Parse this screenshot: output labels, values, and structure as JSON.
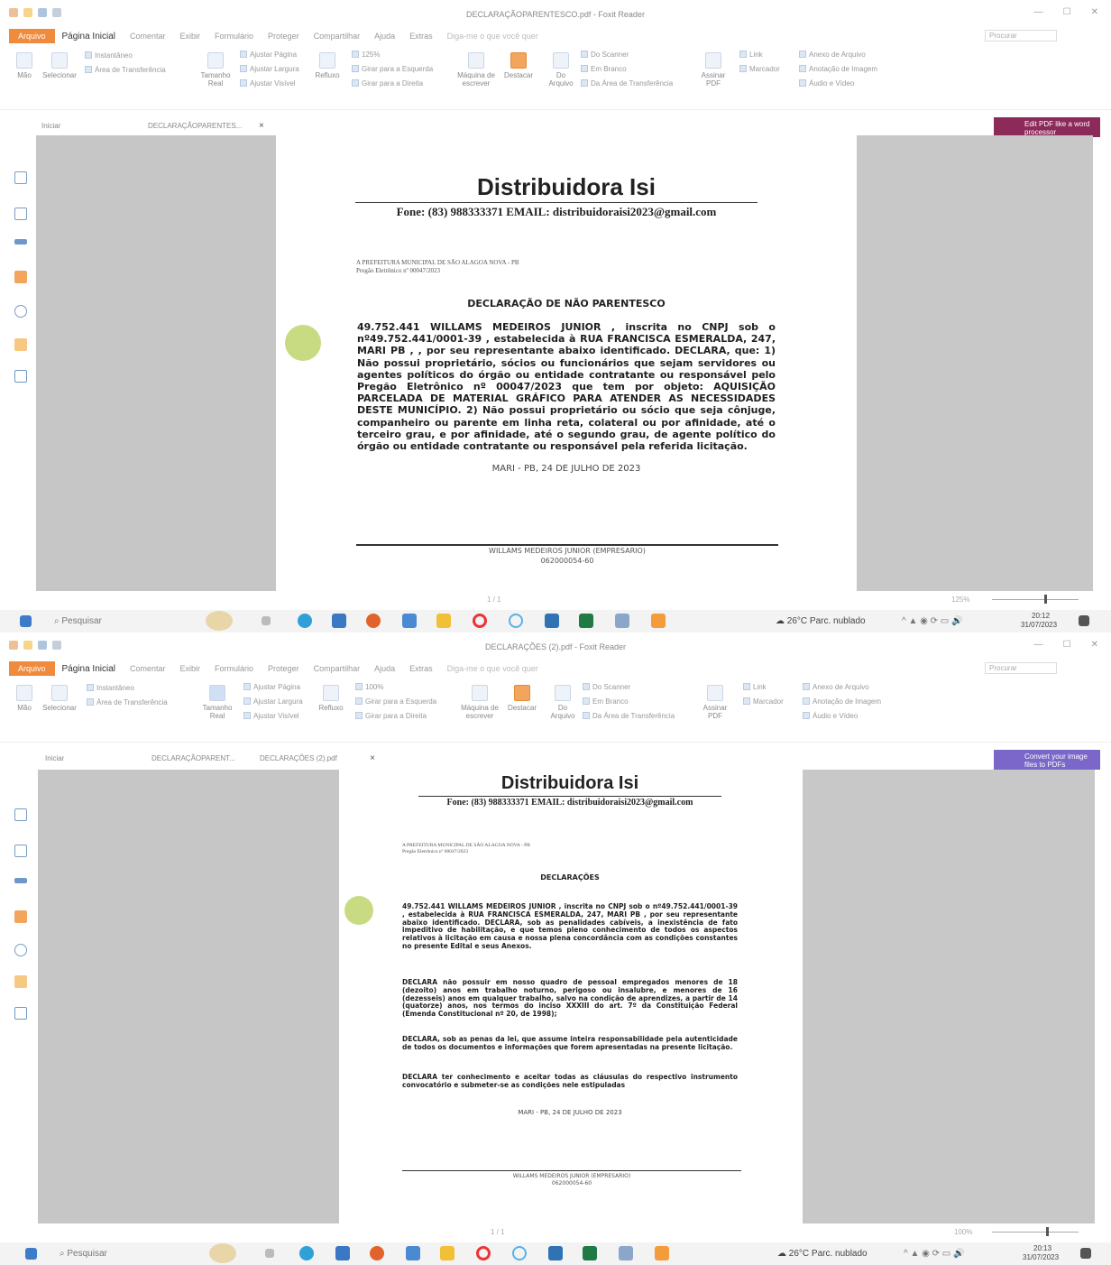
{
  "windows": [
    {
      "title": "DECLARAÇÃOPARENTESCO.pdf - Foxit Reader",
      "menu": [
        "Arquivo",
        "Página Inicial",
        "Comentar",
        "Exibir",
        "Formulário",
        "Proteger",
        "Compartilhar",
        "Ajuda",
        "Extras"
      ],
      "tell_me": "Diga-me o que você quer",
      "search_placeholder": "Procurar",
      "ribbon": {
        "hand": "Mão",
        "select": "Selecionar",
        "snapshot": "Instantâneo",
        "clipboard": "Área de Transferência",
        "actual_size": "Tamanho Real",
        "fit_page": "Ajustar Página",
        "fit_width": "Ajustar Largura",
        "fit_visible": "Ajustar Visível",
        "reflow": "Refluxo",
        "zoom": "125%",
        "rotate_left": "Girar para a Esquerda",
        "rotate_right": "Girar para a Direita",
        "typewriter": "Máquina de escrever",
        "highlight": "Destacar",
        "from_file": "Do Arquivo",
        "from_scanner": "Do Scanner",
        "blank": "Em Branco",
        "from_clipboard": "Da Área de Transferência",
        "sign": "Assinar PDF",
        "link": "Link",
        "bookmark": "Marcador",
        "file_attachment": "Anexo de Arquivo",
        "image_annotation": "Anotação de Imagem",
        "audio_video": "Áudio e Vídeo"
      },
      "tabs": [
        "Iniciar",
        "DECLARAÇÃOPARENTES...",
        "×"
      ],
      "promo": "Edit PDF like a word processor",
      "document": {
        "company": "Distribuidora Isi",
        "phone_line": "Fone: (83) 988333371 EMAIL: distribuidoraisi2023@gmail.com",
        "to_line1": "A PREFEITURA MUNICIPAL DE SÃO ALAGOA NOVA - PB",
        "to_line2": "Pregão Eletrônico nº 00047/2023",
        "heading": "DECLARAÇÃO DE NÃO PARENTESCO",
        "body": "49.752.441 WILLAMS MEDEIROS JUNIOR , inscrita no CNPJ sob o nº49.752.441/0001-39 , estabelecida à RUA FRANCISCA ESMERALDA, 247, MARI PB , , por seu representante abaixo identificado. DECLARA, que: 1) Não possui proprietário, sócios ou funcionários que sejam servidores ou agentes políticos do órgão ou entidade contratante ou responsável pelo Pregão Eletrônico nº 00047/2023 que tem por objeto: AQUISIÇÃO PARCELADA DE MATERIAL GRÁFICO PARA ATENDER AS NECESSIDADES DESTE MUNICÍPIO. 2) Não possui proprietário ou sócio que seja cônjuge, companheiro ou parente em linha reta, colateral ou por afinidade, até o terceiro grau, e por afinidade, até o segundo grau, de agente político do órgão ou entidade contratante ou responsável pela referida licitação.",
        "date": "MARI - PB, 24 DE JULHO DE 2023",
        "signer": "WILLAMS MEDEIROS JUNIOR (EMPRESARIO)",
        "signer_id": "062000054-60"
      },
      "status": {
        "page": "1 / 1",
        "zoom": "125%"
      },
      "taskbar": {
        "search": "Pesquisar",
        "weather": "26°C Parc. nublado",
        "time": "20:12",
        "date": "31/07/2023"
      }
    },
    {
      "title": "DECLARAÇÕES (2).pdf - Foxit Reader",
      "menu": [
        "Arquivo",
        "Página Inicial",
        "Comentar",
        "Exibir",
        "Formulário",
        "Proteger",
        "Compartilhar",
        "Ajuda",
        "Extras"
      ],
      "tell_me": "Diga-me o que você quer",
      "search_placeholder": "Procurar",
      "ribbon": {
        "hand": "Mão",
        "select": "Selecionar",
        "snapshot": "Instantâneo",
        "clipboard": "Área de Transferência",
        "actual_size": "Tamanho Real",
        "fit_page": "Ajustar Página",
        "fit_width": "Ajustar Largura",
        "fit_visible": "Ajustar Visível",
        "reflow": "Refluxo",
        "zoom": "100%",
        "rotate_left": "Girar para a Esquerda",
        "rotate_right": "Girar para a Direita",
        "typewriter": "Máquina de escrever",
        "highlight": "Destacar",
        "from_file": "Do Arquivo",
        "from_scanner": "Do Scanner",
        "blank": "Em Branco",
        "from_clipboard": "Da Área de Transferência",
        "sign": "Assinar PDF",
        "link": "Link",
        "bookmark": "Marcador",
        "file_attachment": "Anexo de Arquivo",
        "image_annotation": "Anotação de Imagem",
        "audio_video": "Áudio e Vídeo"
      },
      "tabs": [
        "Iniciar",
        "DECLARAÇÃOPARENT...",
        "DECLARAÇÕES (2).pdf",
        "×"
      ],
      "promo": "Convert your image files to PDFs",
      "document": {
        "company": "Distribuidora Isi",
        "phone_line": "Fone: (83) 988333371 EMAIL: distribuidoraisi2023@gmail.com",
        "to_line1": "A PREFEITURA MUNICIPAL DE SÃO ALAGOA NOVA - PB",
        "to_line2": "Pregão Eletrônico nº 00047/2023",
        "heading": "DECLARAÇÕES",
        "paragraphs": [
          "49.752.441 WILLAMS MEDEIROS JUNIOR , inscrita no CNPJ sob o nº49.752.441/0001-39 , estabelecida à RUA FRANCISCA ESMERALDA, 247, MARI PB , por seu representante abaixo identificado. DECLARA, sob as penalidades cabíveis, a inexistência de fato impeditivo de habilitação, e que temos pleno conhecimento de todos os aspectos relativos à licitação em causa e nossa plena concordância com as condições constantes no presente Edital e seus Anexos.",
          "DECLARA não possuir em nosso quadro de pessoal empregados menores de 18 (dezoito) anos em trabalho noturno, perigoso ou insalubre, e menores de 16 (dezesseis) anos em qualquer trabalho, salvo na condição de aprendizes, a partir de 14 (quatorze) anos, nos termos do inciso XXXIII do art. 7º da Constituição Federal (Emenda Constitucional nº 20, de 1998);",
          "DECLARA, sob as penas da lei, que assume inteira responsabilidade pela autenticidade de todos os documentos e informações que forem apresentadas na presente licitação.",
          "DECLARA ter conhecimento e aceitar todas as cláusulas do respectivo instrumento convocatório e submeter-se as condições nele estipuladas"
        ],
        "date": "MARI - PB, 24 DE JULHO DE 2023",
        "signer": "WILLAMS MEDEIROS JUNIOR (EMPRESARIO)",
        "signer_id": "062000054-60"
      },
      "status": {
        "page": "1 / 1",
        "zoom": "100%"
      },
      "taskbar": {
        "search": "Pesquisar",
        "weather": "26°C Parc. nublado",
        "time": "20:13",
        "date": "31/07/2023"
      }
    }
  ]
}
